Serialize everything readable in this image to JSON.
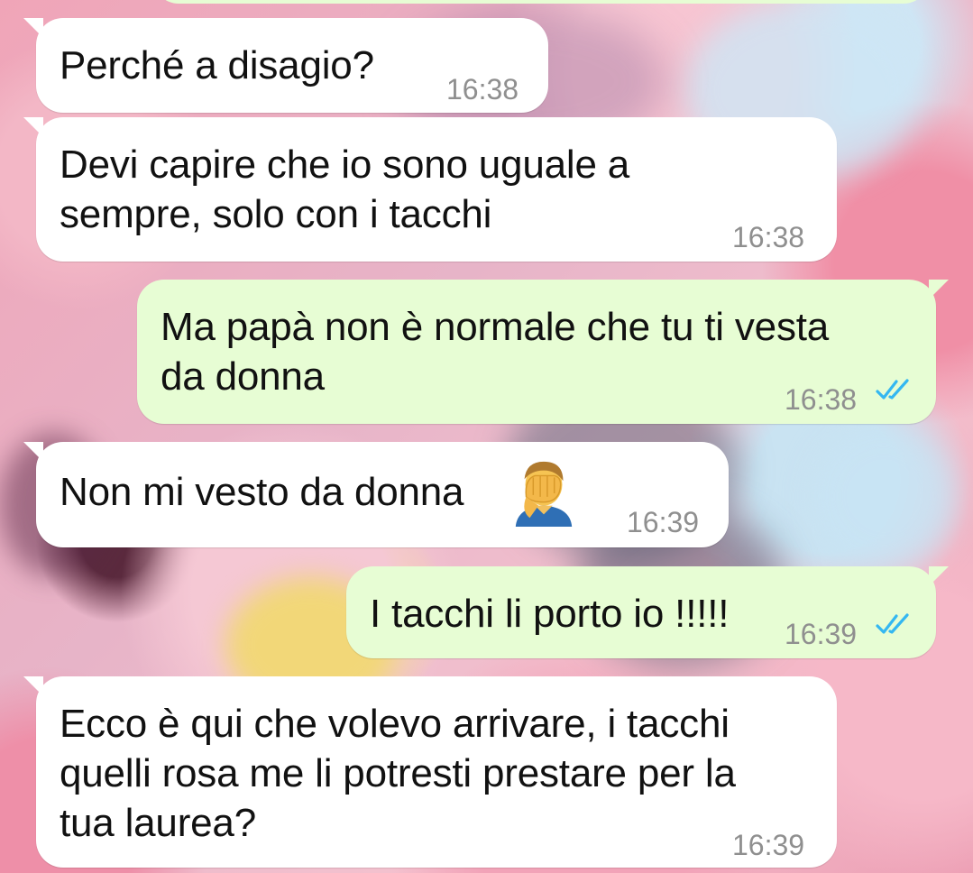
{
  "messages": [
    {
      "direction": "incoming",
      "text": "Perché a disagio?",
      "time": "16:38"
    },
    {
      "direction": "incoming",
      "text": "Devi capire che io sono uguale a\nsempre, solo con i tacchi",
      "time": "16:38"
    },
    {
      "direction": "outgoing",
      "text": "Ma papà non è normale che tu ti vesta\nda donna",
      "time": "16:38",
      "status_icon": "double-check-read-icon"
    },
    {
      "direction": "incoming",
      "text": "Non mi vesto da donna",
      "time": "16:39",
      "emoji": "man-facepalming-emoji"
    },
    {
      "direction": "outgoing",
      "text": "I tacchi li porto io !!!!!",
      "time": "16:39",
      "status_icon": "double-check-read-icon"
    },
    {
      "direction": "incoming",
      "text": "Ecco è qui che volevo arrivare, i tacchi\nquelli rosa me li potresti prestare per la\ntua laurea?",
      "time": "16:39"
    }
  ],
  "colors": {
    "incoming_bubble": "#ffffff",
    "outgoing_bubble": "#e7fdd4",
    "timestamp": "#8f8f8f",
    "read_ticks": "#34b7f1"
  }
}
